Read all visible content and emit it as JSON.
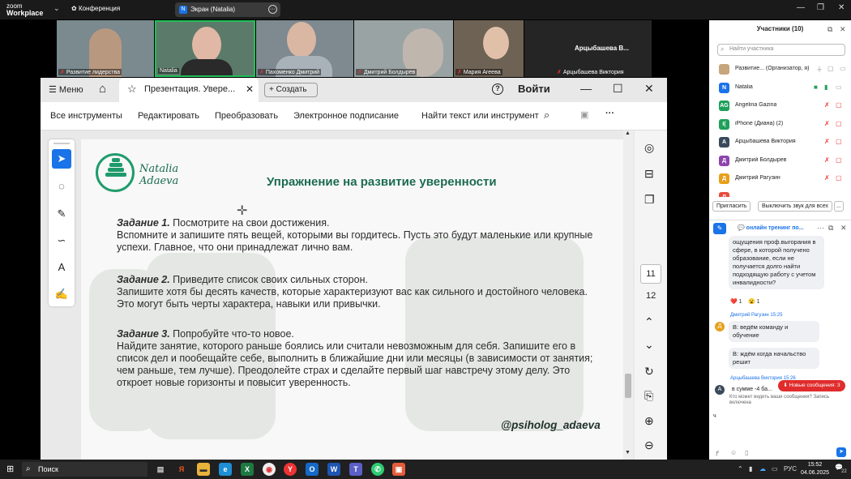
{
  "zoom": {
    "logo_line1": "zoom",
    "logo_line2": "Workplace",
    "conference_label": "Конференция",
    "screen_label": "Экран (Natalia)",
    "screen_badge": "N"
  },
  "video_strip": [
    {
      "name": "Развитие лидерства",
      "bg": "#7a8a8f",
      "muted": true
    },
    {
      "name": "Natalia",
      "bg": "#5c7a6a",
      "muted": false
    },
    {
      "name": "Пахоменко Дмитрий",
      "bg": "#7e8990",
      "muted": true
    },
    {
      "name": "Дмитрий Болдырев",
      "bg": "#9aa3a3",
      "muted": true
    },
    {
      "name": "Мария Агеева",
      "bg": "#6e6254",
      "muted": true
    },
    {
      "name": "Арцыбашева Виктория",
      "bg": "#252525",
      "muted": true,
      "big_label": "Арцыбашева В..."
    }
  ],
  "participants_panel": {
    "title": "Участники (10)",
    "search_placeholder": "Найти участника",
    "participants": [
      {
        "initial": "",
        "name": "Развитие... (Организатор, я)",
        "color": "#c7a57d"
      },
      {
        "initial": "N",
        "name": "Natalia",
        "color": "#1a73e8"
      },
      {
        "initial": "AG",
        "name": "Angelina Gazina",
        "color": "#1fa05a"
      },
      {
        "initial": "I(",
        "name": "iPhone (Диана) (2)",
        "color": "#1fa05a"
      },
      {
        "initial": "А",
        "name": "Арцыбашева Виктория",
        "color": "#3a4a5a"
      },
      {
        "initial": "Д",
        "name": "Дмитрий Болдырев",
        "color": "#8e44ad"
      },
      {
        "initial": "Д",
        "name": "Дмитрий Рагузин",
        "color": "#e6a01a"
      },
      {
        "initial": "Л",
        "name": "",
        "color": "#e74c3c"
      }
    ],
    "invite_label": "Пригласить",
    "mute_all_label": "Выключить звук для всех",
    "more_label": "..."
  },
  "chat": {
    "title": "онлайн тренинг по...",
    "messages": [
      {
        "text": "ощущения проф.выгорания в сфере, в которой получено образование, если не получается долго найти подходящую работу с учетом инвалидности?"
      },
      {
        "text": "В: ведём команду и обучение"
      },
      {
        "text": "В: ждём когда начальство решит"
      }
    ],
    "reactions": [
      "❤️ 1",
      "😮 1"
    ],
    "sender1": "Дмитрий Рагузин 15:25",
    "sender2": "Арцыбашева Виктория 15:26",
    "partial_msg": "в сумме -4 ба...",
    "new_messages": "⬇ Новые сообщения: 3",
    "notice": "Кто может видеть ваши сообщения? Запись включена",
    "typed": "ч"
  },
  "acrobat": {
    "menu_label": "Меню",
    "tab_title": "Презентация. Увере...",
    "create_label": "Создать",
    "login_label": "Войти",
    "toolbar": {
      "all_tools": "Все инструменты",
      "edit": "Редактировать",
      "convert": "Преобразовать",
      "esign": "Электронное подписание",
      "find": "Найти текст или инструмент"
    },
    "page_current": "11",
    "page_next": "12"
  },
  "slide": {
    "logo_name": "Natalia Adaeva",
    "title": "Упражнение на развитие уверенности",
    "tasks": [
      {
        "head": "Задание 1.",
        "lead": " Посмотрите на свои достижения.",
        "body": "Вспомните и запишите пять вещей, которыми вы гордитесь. Пусть это будут маленькие или крупные успехи. Главное, что они принадлежат лично вам."
      },
      {
        "head": "Задание 2.",
        "lead": " Приведите список своих сильных сторон.",
        "body": "Запишите хотя бы десять качеств, которые характеризуют вас как сильного и достойного человека. Это могут быть черты характера, навыки или привычки."
      },
      {
        "head": "Задание 3.",
        "lead": " Попробуйте что-то новое.",
        "body": "Найдите занятие, которого раньше боялись или считали невозможным для себя. Запишите его в список дел и пообещайте себе, выполнить в ближайшие дни или месяцы (в зависимости от занятия; чем раньше, тем лучше). Преодолейте страх и сделайте первый шаг навстречу этому делу. Это откроет новые горизонты и повысит уверенность."
      }
    ],
    "handle": "@psiholog_adaeva"
  },
  "taskbar": {
    "search_label": "Поиск",
    "lang": "РУС",
    "time": "15:52",
    "date": "04.06.2025",
    "notif_count": "22"
  }
}
